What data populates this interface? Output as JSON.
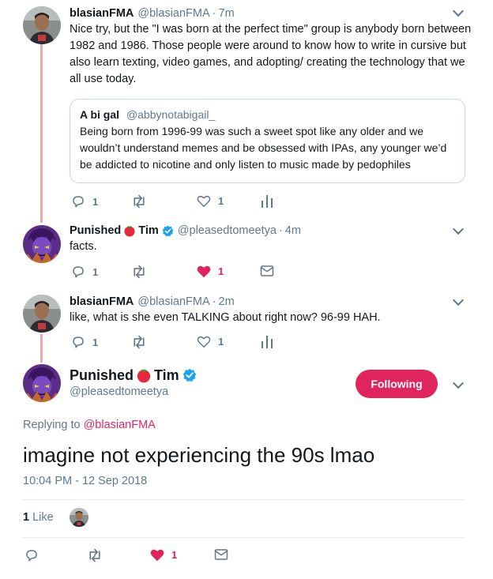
{
  "tweets": [
    {
      "name": "blasianFMA",
      "handle": "@blasianFMA",
      "time": "7m",
      "text": "Nice try, but the \"I was born at the perfect time\" group is anybody born between 1982 and 1986. Those people were around to know how to write in cursive but also learn texting, video games, and adopting/ creating the technology that we all use today.",
      "quote": {
        "name": "A bi gal",
        "handle": "@abbynotabigail_",
        "text": "Being born from 1996-99 was such a sweet spot like any older and we wouldn’t understand memes and be obsessed with IPAs, any younger we’d be addicted to nicotine and only listen to music made by pedophiles"
      },
      "replies": "1",
      "likes": "1"
    },
    {
      "name_part1": "Punished",
      "name_part2": "Tim",
      "handle": "@pleasedtomeetya",
      "time": "4m",
      "text": "facts.",
      "replies": "1",
      "likes": "1"
    },
    {
      "name": "blasianFMA",
      "handle": "@blasianFMA",
      "time": "2m",
      "text": "like, what is she even TALKING about right now? 96-99 HAH.",
      "replies": "1",
      "likes": "1"
    }
  ],
  "main": {
    "name_part1": "Punished",
    "name_part2": "Tim",
    "handle": "@pleasedtomeetya",
    "follow_label": "Following",
    "replying_prefix": "Replying to",
    "replying_to": "@blasianFMA",
    "text": "imagine not experiencing the 90s lmao",
    "timestamp": "10:04 PM - 12 Sep 2018",
    "like_count": "1",
    "like_label": "Like",
    "action_likes": "1"
  },
  "colors": {
    "accent": "#e0245e",
    "verified": "#1da1f2",
    "muted": "#657786",
    "thread": "#f4a6a6"
  },
  "icons": [
    "reply-icon",
    "retweet-icon",
    "heart-icon",
    "analytics-icon",
    "dm-icon",
    "verified-icon",
    "tomato-emoji",
    "chevron-down-icon"
  ]
}
